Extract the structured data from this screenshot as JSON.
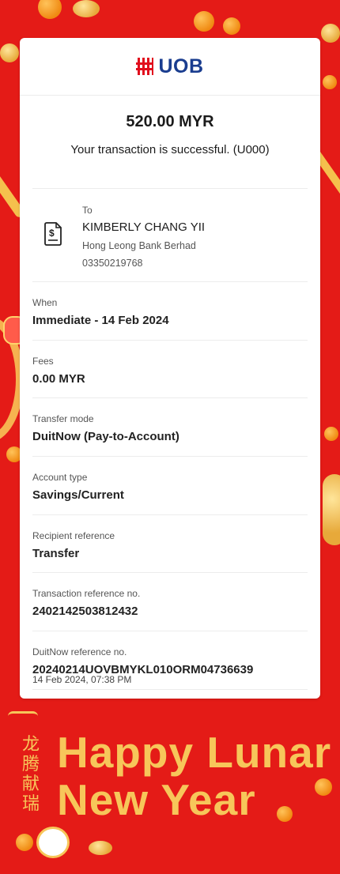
{
  "brand": {
    "name": "UOB"
  },
  "transaction": {
    "amount": "520.00 MYR",
    "status": "Your transaction is successful. (U000)"
  },
  "recipient": {
    "label": "To",
    "name": "KIMBERLY CHANG YII",
    "bank": "Hong Leong Bank Berhad",
    "account": "03350219768",
    "icon": "document-dollar-icon"
  },
  "details": [
    {
      "label": "When",
      "value": "Immediate - 14 Feb 2024"
    },
    {
      "label": "Fees",
      "value": "0.00 MYR"
    },
    {
      "label": "Transfer mode",
      "value": "DuitNow (Pay-to-Account)"
    },
    {
      "label": "Account type",
      "value": "Savings/Current"
    },
    {
      "label": "Recipient reference",
      "value": "Transfer"
    },
    {
      "label": "Transaction reference no.",
      "value": "2402142503812432"
    },
    {
      "label": "DuitNow reference no.",
      "value": "20240214UOVBMYKL010ORM04736639"
    }
  ],
  "timestamp": "14 Feb 2024, 07:38 PM",
  "banner": {
    "chinese": "龙腾献瑞",
    "line1": "Happy Lunar",
    "line2": "New Year"
  },
  "colors": {
    "background": "#e41b17",
    "brand_red": "#e10e1d",
    "brand_blue": "#1a3d8f",
    "gold": "#f7c65a"
  }
}
